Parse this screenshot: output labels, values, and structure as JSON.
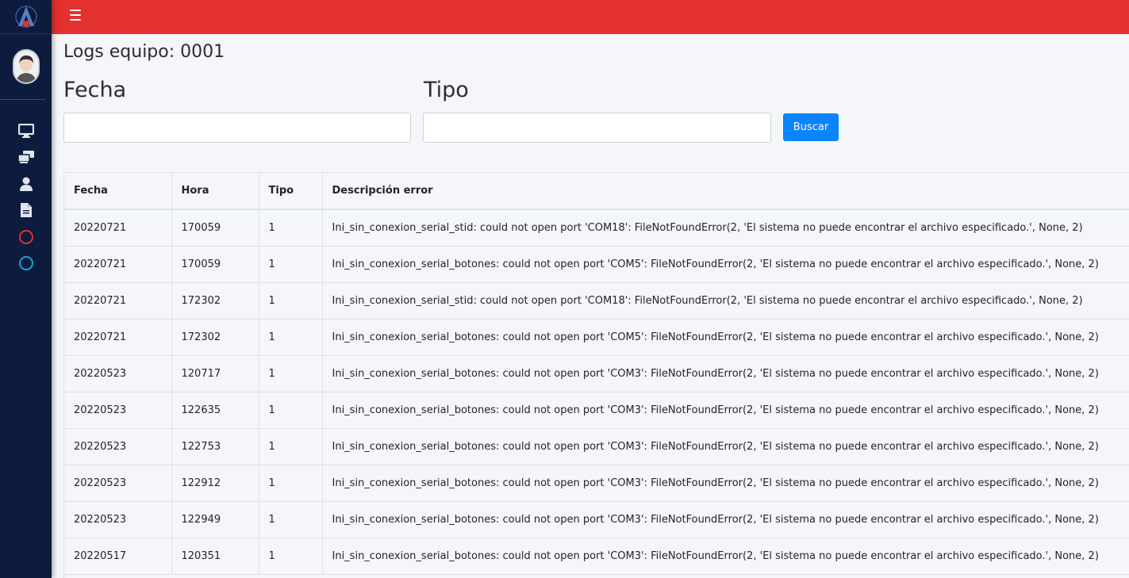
{
  "topbar": {
    "menu_icon": "hamburger-icon",
    "color": "#e3312f"
  },
  "sidebar": {
    "logo_icon": "app-logo-icon",
    "items": [
      {
        "icon": "monitor-icon"
      },
      {
        "icon": "devices-icon"
      },
      {
        "icon": "user-icon"
      },
      {
        "icon": "document-icon"
      },
      {
        "icon": "red-circle-icon",
        "color": "#e3312f"
      },
      {
        "icon": "cyan-circle-icon",
        "color": "#1aa3c9"
      }
    ]
  },
  "page": {
    "title": "Logs equipo: 0001"
  },
  "filters": {
    "fecha_label": "Fecha",
    "fecha_value": "",
    "tipo_label": "Tipo",
    "tipo_value": "",
    "search_button": "Buscar"
  },
  "table": {
    "headers": [
      "Fecha",
      "Hora",
      "Tipo",
      "Descripción error"
    ],
    "rows": [
      [
        "20220721",
        "170059",
        "1",
        "Ini_sin_conexion_serial_stid: could not open port 'COM18': FileNotFoundError(2, 'El sistema no puede encontrar el archivo especificado.', None, 2)"
      ],
      [
        "20220721",
        "170059",
        "1",
        "Ini_sin_conexion_serial_botones: could not open port 'COM5': FileNotFoundError(2, 'El sistema no puede encontrar el archivo especificado.', None, 2)"
      ],
      [
        "20220721",
        "172302",
        "1",
        "Ini_sin_conexion_serial_stid: could not open port 'COM18': FileNotFoundError(2, 'El sistema no puede encontrar el archivo especificado.', None, 2)"
      ],
      [
        "20220721",
        "172302",
        "1",
        "Ini_sin_conexion_serial_botones: could not open port 'COM5': FileNotFoundError(2, 'El sistema no puede encontrar el archivo especificado.', None, 2)"
      ],
      [
        "20220523",
        "120717",
        "1",
        "Ini_sin_conexion_serial_botones: could not open port 'COM3': FileNotFoundError(2, 'El sistema no puede encontrar el archivo especificado.', None, 2)"
      ],
      [
        "20220523",
        "122635",
        "1",
        "Ini_sin_conexion_serial_botones: could not open port 'COM3': FileNotFoundError(2, 'El sistema no puede encontrar el archivo especificado.', None, 2)"
      ],
      [
        "20220523",
        "122753",
        "1",
        "Ini_sin_conexion_serial_botones: could not open port 'COM3': FileNotFoundError(2, 'El sistema no puede encontrar el archivo especificado.', None, 2)"
      ],
      [
        "20220523",
        "122912",
        "1",
        "Ini_sin_conexion_serial_botones: could not open port 'COM3': FileNotFoundError(2, 'El sistema no puede encontrar el archivo especificado.', None, 2)"
      ],
      [
        "20220523",
        "122949",
        "1",
        "Ini_sin_conexion_serial_botones: could not open port 'COM3': FileNotFoundError(2, 'El sistema no puede encontrar el archivo especificado.', None, 2)"
      ],
      [
        "20220517",
        "120351",
        "1",
        "Ini_sin_conexion_serial_botones: could not open port 'COM3': FileNotFoundError(2, 'El sistema no puede encontrar el archivo especificado.', None, 2)"
      ]
    ]
  }
}
